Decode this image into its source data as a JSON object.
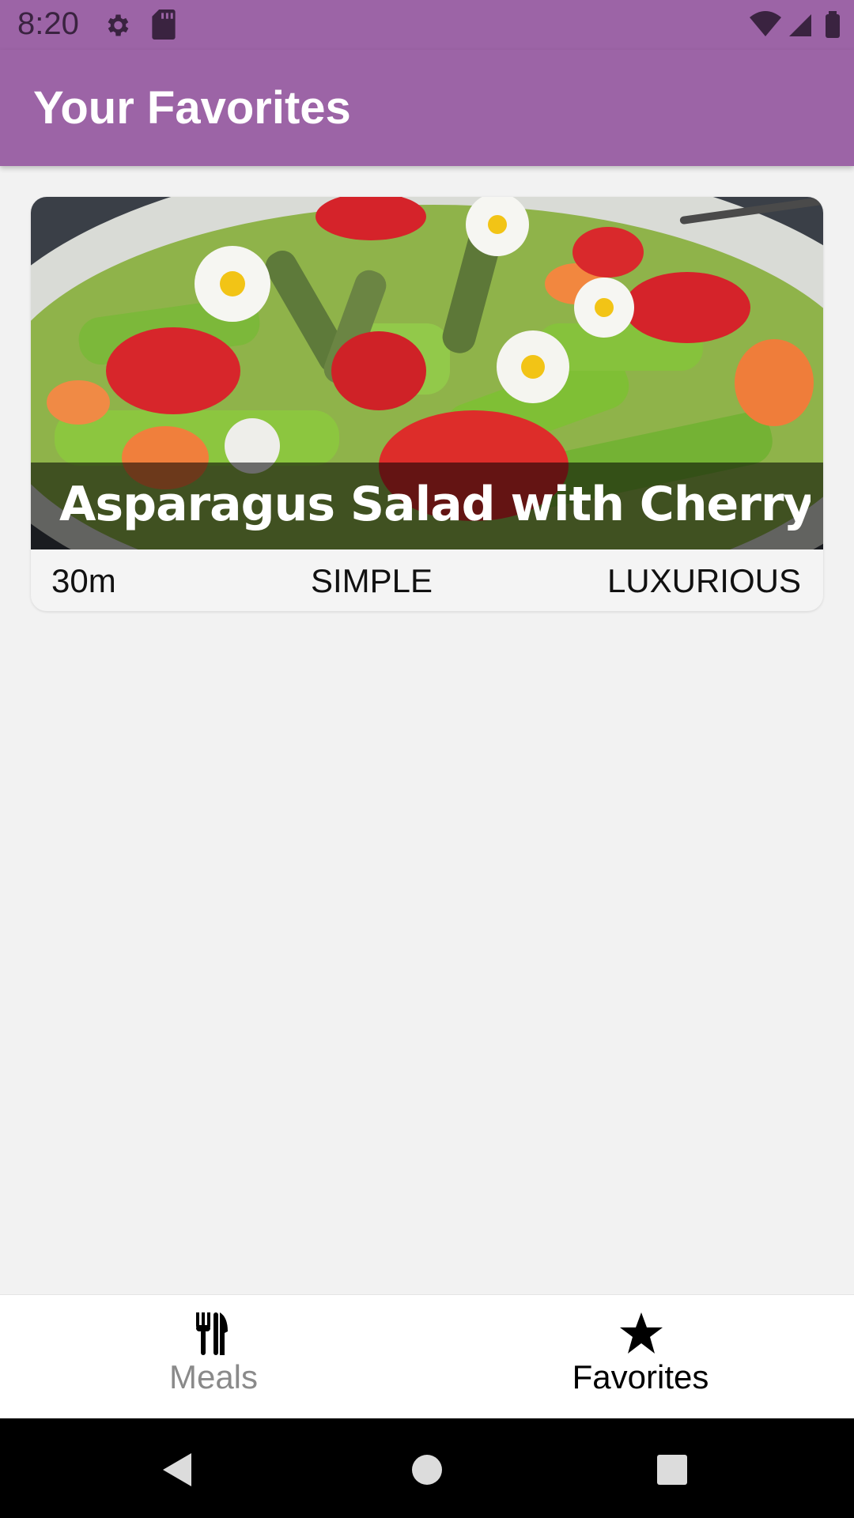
{
  "status_bar": {
    "time": "8:20",
    "icons": [
      "gear-icon",
      "sd-card-icon",
      "wifi-icon",
      "signal-icon",
      "battery-icon"
    ]
  },
  "app_bar": {
    "title": "Your Favorites",
    "color": "#9c64a6"
  },
  "favorites": [
    {
      "title": "Asparagus Salad with Cherry...",
      "duration": "30m",
      "complexity": "SIMPLE",
      "affordability": "LUXURIOUS",
      "image": "salad-photo"
    }
  ],
  "bottom_nav": {
    "items": [
      {
        "label": "Meals",
        "icon": "restaurant-icon",
        "selected": false
      },
      {
        "label": "Favorites",
        "icon": "star-icon",
        "selected": true
      }
    ]
  },
  "system_nav": {
    "icons": [
      "back-icon",
      "home-icon",
      "recents-icon"
    ]
  }
}
